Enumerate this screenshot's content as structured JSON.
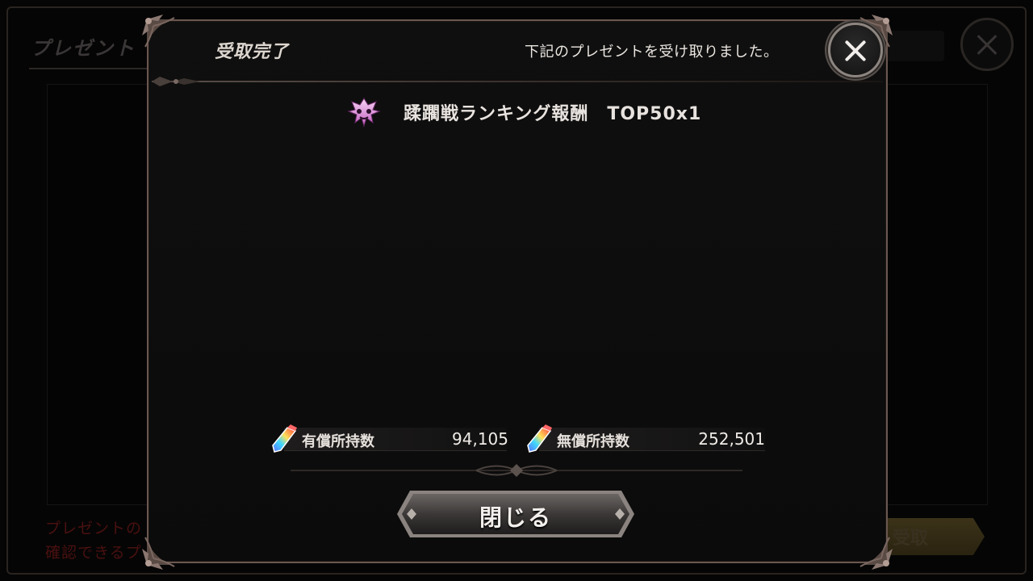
{
  "background": {
    "title": "プレゼント",
    "footer_line1": "プレゼントの",
    "footer_line2": "確認できるプ",
    "receive_button": "受取"
  },
  "dialog": {
    "title": "受取完了",
    "message": "下記のプレゼントを受け取りました。",
    "reward": {
      "icon": "ranking-emblem-icon",
      "label": "蹂躙戦ランキング報酬　TOP50x1"
    },
    "holdings": {
      "paid_label": "有償所持数",
      "paid_value": "94,105",
      "free_label": "無償所持数",
      "free_value": "252,501"
    },
    "close_button": "閉じる"
  },
  "colors": {
    "frame": "#6a5750",
    "panel": "#0d0d0d",
    "text": "#e6e1dc"
  }
}
